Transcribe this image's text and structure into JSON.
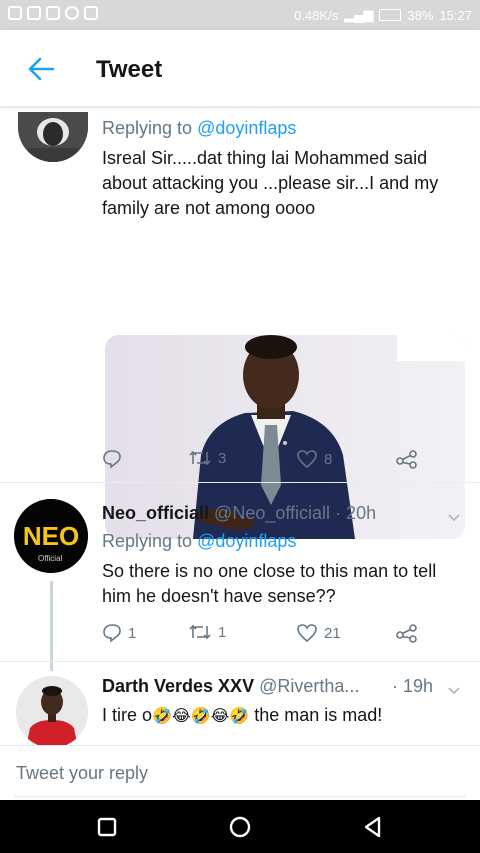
{
  "status_bar": {
    "speed": "0.48K/s",
    "battery": "38%",
    "time": "15:27"
  },
  "header": {
    "title": "Tweet"
  },
  "tweet1": {
    "reply_prefix": "Replying to",
    "reply_handle": "@doyinflaps",
    "text": "Isreal Sir.....dat thing lai Mohammed said about attacking you ...please sir...I and my family are not among oooo",
    "retweets": "3",
    "likes": "8"
  },
  "tweet2": {
    "name": "Neo_officiall",
    "handle": "@Neo_officiall",
    "time": "· 20h",
    "avatar_text": "NEO",
    "avatar_subtext": "Official",
    "reply_prefix": "Replying to",
    "reply_handle": "@doyinflaps",
    "text": "So there is no one close to this man to tell him he doesn't have sense??",
    "replies": "1",
    "retweets": "1",
    "likes": "21"
  },
  "tweet3": {
    "name": "Darth Verdes XXV",
    "handle": "@Rivertha...",
    "time": "· 19h",
    "text_start": "I tire o",
    "emojis": "🤣😂🤣😂🤣",
    "text_end": "the man is mad!"
  },
  "reply_bar": {
    "placeholder": "Tweet your reply"
  },
  "colors": {
    "accent": "#1da1f2",
    "secondary_text": "#657786"
  }
}
